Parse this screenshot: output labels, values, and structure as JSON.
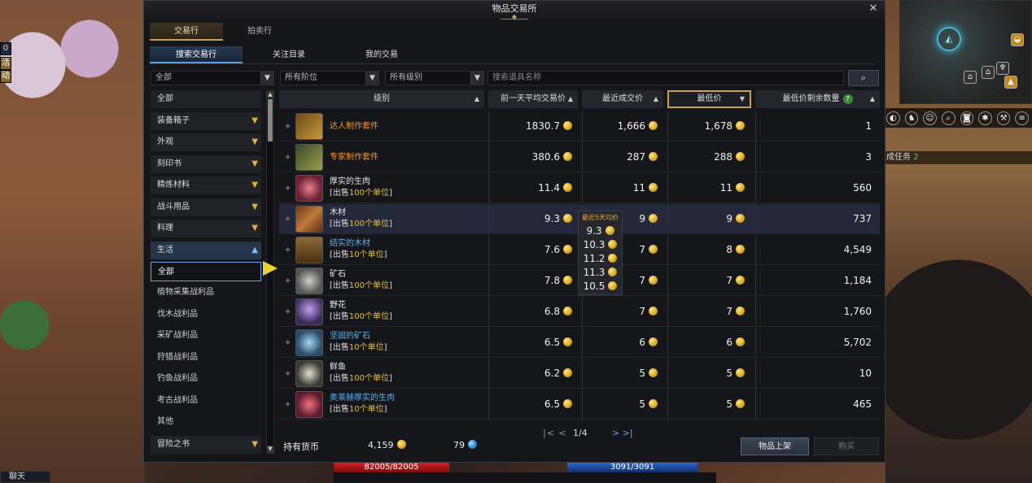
{
  "window": {
    "title": "物品交易所",
    "close": "✕"
  },
  "tabs_top": [
    "交易行",
    "拍卖行"
  ],
  "tabs_sub": [
    "搜索交易行",
    "关注目录",
    "我的交易"
  ],
  "filters": {
    "category": "全部",
    "tier": "所有阶位",
    "grade": "所有级别",
    "search_placeholder": "搜索道具名称"
  },
  "categories": [
    {
      "label": "全部",
      "chev": ""
    },
    {
      "label": "装备箱子",
      "chev": "▼"
    },
    {
      "label": "外观",
      "chev": "▼"
    },
    {
      "label": "刻印书",
      "chev": "▼"
    },
    {
      "label": "精炼材料",
      "chev": "▼"
    },
    {
      "label": "战斗用品",
      "chev": "▼"
    },
    {
      "label": "料理",
      "chev": "▼"
    },
    {
      "label": "生活",
      "chev": "▲"
    }
  ],
  "subcategories": [
    "全部",
    "植物采集战利品",
    "伐木战利品",
    "采矿战利品",
    "狩猎战利品",
    "钓鱼战利品",
    "考古战利品",
    "其他"
  ],
  "category_last": {
    "label": "冒险之书",
    "chev": "▼"
  },
  "columns": {
    "grade": "级别",
    "avg": "前一天平均交易价",
    "recent": "最近成交价",
    "lowest": "最低价",
    "remaining": "最低价剩余数量",
    "help": "?"
  },
  "rows": [
    {
      "name": "达人制作套件",
      "unit": "",
      "unit_pre": "",
      "unit_post": "",
      "avg": "1830.7",
      "recent": "1,666",
      "lowest": "1,678",
      "qty": "1",
      "color": "orange"
    },
    {
      "name": "专家制作套件",
      "unit": "",
      "unit_pre": "",
      "unit_post": "",
      "avg": "380.6",
      "recent": "287",
      "lowest": "288",
      "qty": "3",
      "color": "orange"
    },
    {
      "name": "厚实的生肉",
      "unit_pre": "[出售",
      "unit": "100个单位",
      "unit_post": "]",
      "avg": "11.4",
      "recent": "11",
      "lowest": "11",
      "qty": "560",
      "color": ""
    },
    {
      "name": "木材",
      "unit_pre": "[出售",
      "unit": "100个单位",
      "unit_post": "]",
      "avg": "9.3",
      "recent": "9",
      "lowest": "9",
      "qty": "737",
      "color": ""
    },
    {
      "name": "结实的木材",
      "unit_pre": "[出售",
      "unit": "10个单位",
      "unit_post": "]",
      "avg": "7.6",
      "recent": "7",
      "lowest": "8",
      "qty": "4,549",
      "color": "blue"
    },
    {
      "name": "矿石",
      "unit_pre": "[出售",
      "unit": "100个单位",
      "unit_post": "]",
      "avg": "7.8",
      "recent": "7",
      "lowest": "7",
      "qty": "1,184",
      "color": ""
    },
    {
      "name": "野花",
      "unit_pre": "[出售",
      "unit": "100个单位",
      "unit_post": "]",
      "avg": "6.8",
      "recent": "7",
      "lowest": "7",
      "qty": "1,760",
      "color": ""
    },
    {
      "name": "坚固的矿石",
      "unit_pre": "[出售",
      "unit": "10个单位",
      "unit_post": "]",
      "avg": "6.5",
      "recent": "6",
      "lowest": "6",
      "qty": "5,702",
      "color": "blue"
    },
    {
      "name": "鲜鱼",
      "unit_pre": "[出售",
      "unit": "100个单位",
      "unit_post": "]",
      "avg": "6.2",
      "recent": "5",
      "lowest": "5",
      "qty": "10",
      "color": ""
    },
    {
      "name": "奥莱赫厚实的生肉",
      "unit_pre": "[出售",
      "unit": "10个单位",
      "unit_post": "]",
      "avg": "6.5",
      "recent": "5",
      "lowest": "5",
      "qty": "465",
      "color": "blue"
    }
  ],
  "tooltip": {
    "title": "最近5天均价",
    "values": [
      "9.3",
      "10.3",
      "11.2",
      "11.3",
      "10.5"
    ]
  },
  "pager": {
    "first_prev": "|<  <",
    "page": "1/4",
    "next_last": ">  >|"
  },
  "footer": {
    "holding_label": "持有货币",
    "gold": "4,159",
    "crystal": "79",
    "list_btn": "物品上架",
    "buy_btn": "购买"
  },
  "hud": {
    "hp": "82005/82005",
    "mp": "3091/3091",
    "chat": "聊天",
    "quest": "成任务",
    "quest_count": "2",
    "left_badges": [
      "0",
      "活",
      "动"
    ]
  },
  "colors": {
    "accent_gold": "#c9a250",
    "accent_blue": "#5aa0e0",
    "orange_text": "#f09a3a",
    "blue_text": "#5ab4f0"
  }
}
